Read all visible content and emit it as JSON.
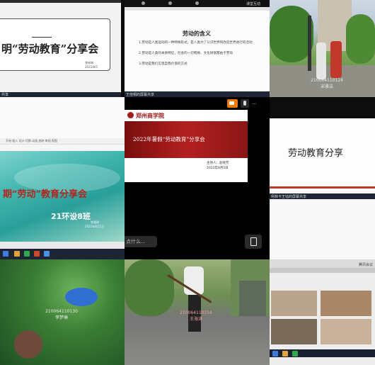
{
  "tile1": {
    "title_prefix": "明",
    "title_main": "“劳动教育”分享会",
    "author": "李梓琦",
    "date": "2022/8/5",
    "footer_text": "共享"
  },
  "tile2": {
    "top_label": "课堂互动",
    "slide_title": "劳动的含义",
    "point1": "1.劳动是人类运动的一种特殊形式，是人类为了认识世界和改造世界进行的活动",
    "point2": "2.劳动是人类的本质特征，社会的一切物质、文化财富都由于劳动",
    "point3": "3.劳动是我们实现自我价值的方式",
    "footer_text": "王佳桐的屏幕共享"
  },
  "tile3": {
    "student_id": "210064110124",
    "student_name": "宋雅洁"
  },
  "tile4": {
    "ribbon": "开始 插入 设计 切换 动画 放映 审阅 视图",
    "title_prefix": "期",
    "title_main": "“劳动”教育分享会",
    "class_name": "21环设8班",
    "presenter": "李雅琦",
    "date": "2022年8月5日"
  },
  "tile5": {
    "school_name": "郑州商学院",
    "slide_title": "2022年暑假“劳动教育”分享会",
    "host_label": "主持人：赵晓芳",
    "date": "2022年8月5日",
    "chat_placeholder": "点什么...",
    "camera_icon": "camera-icon",
    "mic_icon": "mic-icon",
    "more_label": "...",
    "share_icon": "screen-share-icon"
  },
  "tile6": {
    "slide_title": "劳动教育分享",
    "footer_text": "柯林卡王钰的屏幕共享"
  },
  "tile7": {
    "student_id": "210064110130",
    "student_name": "李梦琳"
  },
  "tile8": {
    "student_id": "210064110154",
    "student_name": "王海涛"
  },
  "tile9": {
    "footer_text": "腾讯会议"
  },
  "colors": {
    "accent_red": "#c0392b",
    "dark_red_slide": "#8a1616",
    "teal_slide": "#2a9f9a",
    "meeting_orange": "#f07800"
  }
}
